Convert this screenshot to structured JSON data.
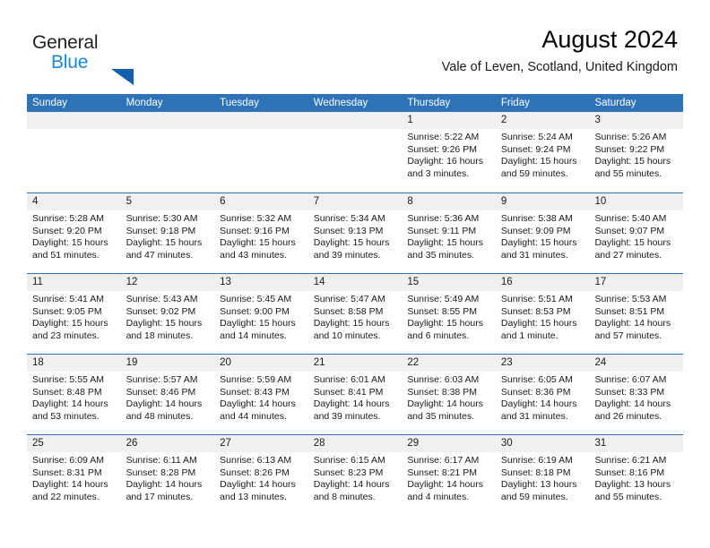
{
  "brand": {
    "name_part1": "General",
    "name_part2": "Blue",
    "triangle_icon": "triangle-logo-icon",
    "color_dark": "#231f20",
    "color_blue": "#1e87d7",
    "color_triangle": "#1560a8"
  },
  "header": {
    "title": "August 2024",
    "subtitle": "Vale of Leven, Scotland, United Kingdom"
  },
  "theme": {
    "header_blue": "#2e72b8",
    "date_strip_gray": "#f0f0f0",
    "text": "#1a1a1a"
  },
  "calendar": {
    "weekdays": [
      "Sunday",
      "Monday",
      "Tuesday",
      "Wednesday",
      "Thursday",
      "Friday",
      "Saturday"
    ],
    "weeks": [
      [
        {
          "day": "",
          "lines": []
        },
        {
          "day": "",
          "lines": []
        },
        {
          "day": "",
          "lines": []
        },
        {
          "day": "",
          "lines": []
        },
        {
          "day": "1",
          "lines": [
            "Sunrise: 5:22 AM",
            "Sunset: 9:26 PM",
            "Daylight: 16 hours",
            "and 3 minutes."
          ]
        },
        {
          "day": "2",
          "lines": [
            "Sunrise: 5:24 AM",
            "Sunset: 9:24 PM",
            "Daylight: 15 hours",
            "and 59 minutes."
          ]
        },
        {
          "day": "3",
          "lines": [
            "Sunrise: 5:26 AM",
            "Sunset: 9:22 PM",
            "Daylight: 15 hours",
            "and 55 minutes."
          ]
        }
      ],
      [
        {
          "day": "4",
          "lines": [
            "Sunrise: 5:28 AM",
            "Sunset: 9:20 PM",
            "Daylight: 15 hours",
            "and 51 minutes."
          ]
        },
        {
          "day": "5",
          "lines": [
            "Sunrise: 5:30 AM",
            "Sunset: 9:18 PM",
            "Daylight: 15 hours",
            "and 47 minutes."
          ]
        },
        {
          "day": "6",
          "lines": [
            "Sunrise: 5:32 AM",
            "Sunset: 9:16 PM",
            "Daylight: 15 hours",
            "and 43 minutes."
          ]
        },
        {
          "day": "7",
          "lines": [
            "Sunrise: 5:34 AM",
            "Sunset: 9:13 PM",
            "Daylight: 15 hours",
            "and 39 minutes."
          ]
        },
        {
          "day": "8",
          "lines": [
            "Sunrise: 5:36 AM",
            "Sunset: 9:11 PM",
            "Daylight: 15 hours",
            "and 35 minutes."
          ]
        },
        {
          "day": "9",
          "lines": [
            "Sunrise: 5:38 AM",
            "Sunset: 9:09 PM",
            "Daylight: 15 hours",
            "and 31 minutes."
          ]
        },
        {
          "day": "10",
          "lines": [
            "Sunrise: 5:40 AM",
            "Sunset: 9:07 PM",
            "Daylight: 15 hours",
            "and 27 minutes."
          ]
        }
      ],
      [
        {
          "day": "11",
          "lines": [
            "Sunrise: 5:41 AM",
            "Sunset: 9:05 PM",
            "Daylight: 15 hours",
            "and 23 minutes."
          ]
        },
        {
          "day": "12",
          "lines": [
            "Sunrise: 5:43 AM",
            "Sunset: 9:02 PM",
            "Daylight: 15 hours",
            "and 18 minutes."
          ]
        },
        {
          "day": "13",
          "lines": [
            "Sunrise: 5:45 AM",
            "Sunset: 9:00 PM",
            "Daylight: 15 hours",
            "and 14 minutes."
          ]
        },
        {
          "day": "14",
          "lines": [
            "Sunrise: 5:47 AM",
            "Sunset: 8:58 PM",
            "Daylight: 15 hours",
            "and 10 minutes."
          ]
        },
        {
          "day": "15",
          "lines": [
            "Sunrise: 5:49 AM",
            "Sunset: 8:55 PM",
            "Daylight: 15 hours",
            "and 6 minutes."
          ]
        },
        {
          "day": "16",
          "lines": [
            "Sunrise: 5:51 AM",
            "Sunset: 8:53 PM",
            "Daylight: 15 hours",
            "and 1 minute."
          ]
        },
        {
          "day": "17",
          "lines": [
            "Sunrise: 5:53 AM",
            "Sunset: 8:51 PM",
            "Daylight: 14 hours",
            "and 57 minutes."
          ]
        }
      ],
      [
        {
          "day": "18",
          "lines": [
            "Sunrise: 5:55 AM",
            "Sunset: 8:48 PM",
            "Daylight: 14 hours",
            "and 53 minutes."
          ]
        },
        {
          "day": "19",
          "lines": [
            "Sunrise: 5:57 AM",
            "Sunset: 8:46 PM",
            "Daylight: 14 hours",
            "and 48 minutes."
          ]
        },
        {
          "day": "20",
          "lines": [
            "Sunrise: 5:59 AM",
            "Sunset: 8:43 PM",
            "Daylight: 14 hours",
            "and 44 minutes."
          ]
        },
        {
          "day": "21",
          "lines": [
            "Sunrise: 6:01 AM",
            "Sunset: 8:41 PM",
            "Daylight: 14 hours",
            "and 39 minutes."
          ]
        },
        {
          "day": "22",
          "lines": [
            "Sunrise: 6:03 AM",
            "Sunset: 8:38 PM",
            "Daylight: 14 hours",
            "and 35 minutes."
          ]
        },
        {
          "day": "23",
          "lines": [
            "Sunrise: 6:05 AM",
            "Sunset: 8:36 PM",
            "Daylight: 14 hours",
            "and 31 minutes."
          ]
        },
        {
          "day": "24",
          "lines": [
            "Sunrise: 6:07 AM",
            "Sunset: 8:33 PM",
            "Daylight: 14 hours",
            "and 26 minutes."
          ]
        }
      ],
      [
        {
          "day": "25",
          "lines": [
            "Sunrise: 6:09 AM",
            "Sunset: 8:31 PM",
            "Daylight: 14 hours",
            "and 22 minutes."
          ]
        },
        {
          "day": "26",
          "lines": [
            "Sunrise: 6:11 AM",
            "Sunset: 8:28 PM",
            "Daylight: 14 hours",
            "and 17 minutes."
          ]
        },
        {
          "day": "27",
          "lines": [
            "Sunrise: 6:13 AM",
            "Sunset: 8:26 PM",
            "Daylight: 14 hours",
            "and 13 minutes."
          ]
        },
        {
          "day": "28",
          "lines": [
            "Sunrise: 6:15 AM",
            "Sunset: 8:23 PM",
            "Daylight: 14 hours",
            "and 8 minutes."
          ]
        },
        {
          "day": "29",
          "lines": [
            "Sunrise: 6:17 AM",
            "Sunset: 8:21 PM",
            "Daylight: 14 hours",
            "and 4 minutes."
          ]
        },
        {
          "day": "30",
          "lines": [
            "Sunrise: 6:19 AM",
            "Sunset: 8:18 PM",
            "Daylight: 13 hours",
            "and 59 minutes."
          ]
        },
        {
          "day": "31",
          "lines": [
            "Sunrise: 6:21 AM",
            "Sunset: 8:16 PM",
            "Daylight: 13 hours",
            "and 55 minutes."
          ]
        }
      ]
    ]
  }
}
